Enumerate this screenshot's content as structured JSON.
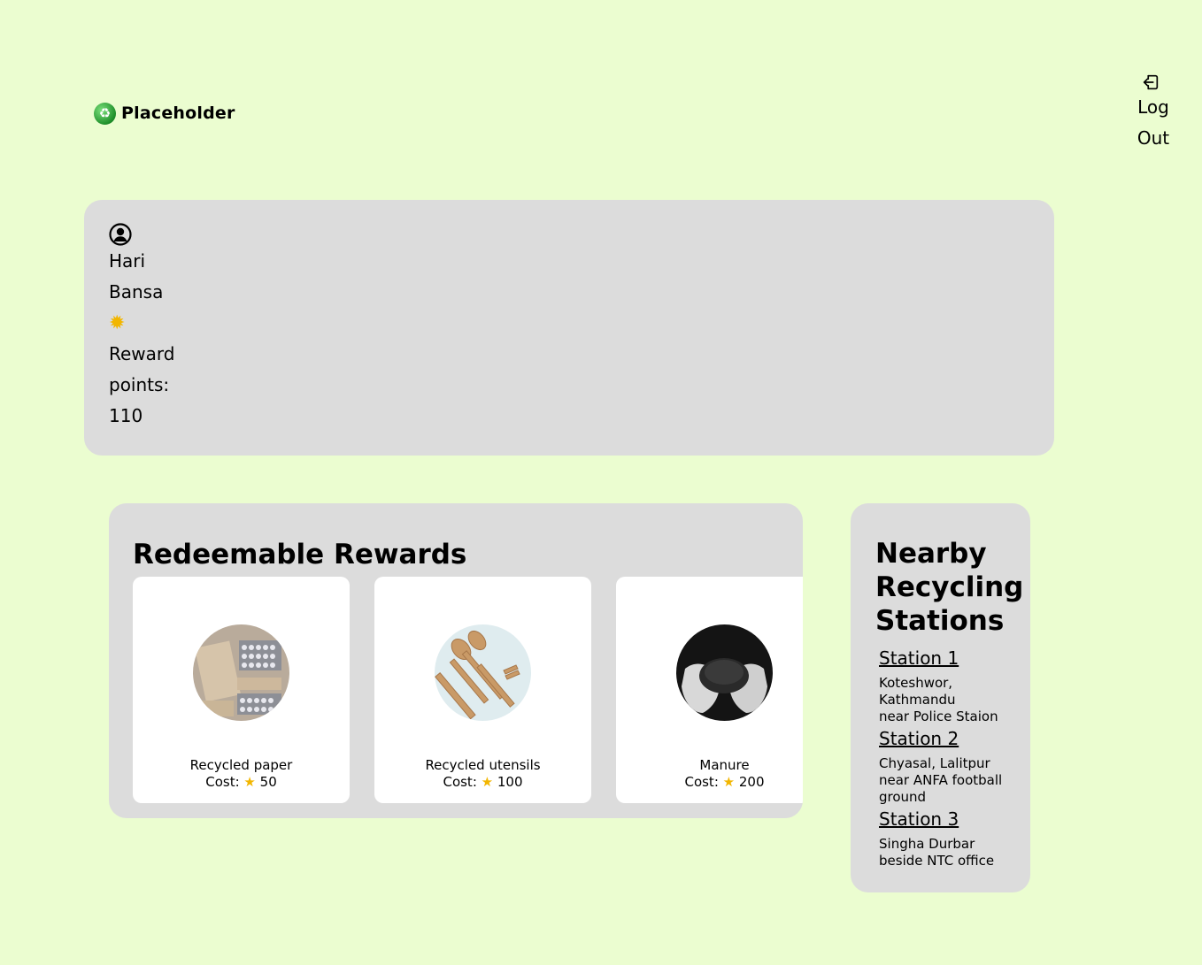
{
  "header": {
    "brand_icon": "recycle-icon",
    "brand_name": "Placeholder",
    "logout_icon": "logout-icon",
    "logout_line1": "Log",
    "logout_line2": "Out"
  },
  "profile": {
    "user_icon": "user-circle-icon",
    "first_name": "Hari",
    "last_name": "Bansa",
    "star_icon": "sparkle-star-icon",
    "reward_label_1": "Reward",
    "reward_label_2": "points:",
    "reward_points": "110"
  },
  "rewards": {
    "title": "Redeemable Rewards",
    "items": [
      {
        "name": "Recycled paper",
        "cost_prefix": "Cost:",
        "cost_value": "50",
        "image": "recycled-paper-photo"
      },
      {
        "name": "Recycled utensils",
        "cost_prefix": "Cost:",
        "cost_value": "100",
        "image": "recycled-utensils-photo"
      },
      {
        "name": "Manure",
        "cost_prefix": "Cost:",
        "cost_value": "200",
        "image": "manure-photo"
      }
    ]
  },
  "stations": {
    "title_line1": "Nearby",
    "title_line2": "Recycling",
    "title_line3": "Stations",
    "items": [
      {
        "name": "Station 1",
        "address": "Koteshwor,\nKathmandu\nnear Police Staion"
      },
      {
        "name": "Station 2",
        "address": "Chyasal, Lalitpur\nnear ANFA football\nground"
      },
      {
        "name": "Station 3",
        "address": "Singha Durbar\nbeside NTC office"
      }
    ]
  },
  "colors": {
    "page_background": "#ebfdd0",
    "card_background": "#dcdcdc",
    "reward_card_background": "#ffffff",
    "star": "#f2b600"
  }
}
